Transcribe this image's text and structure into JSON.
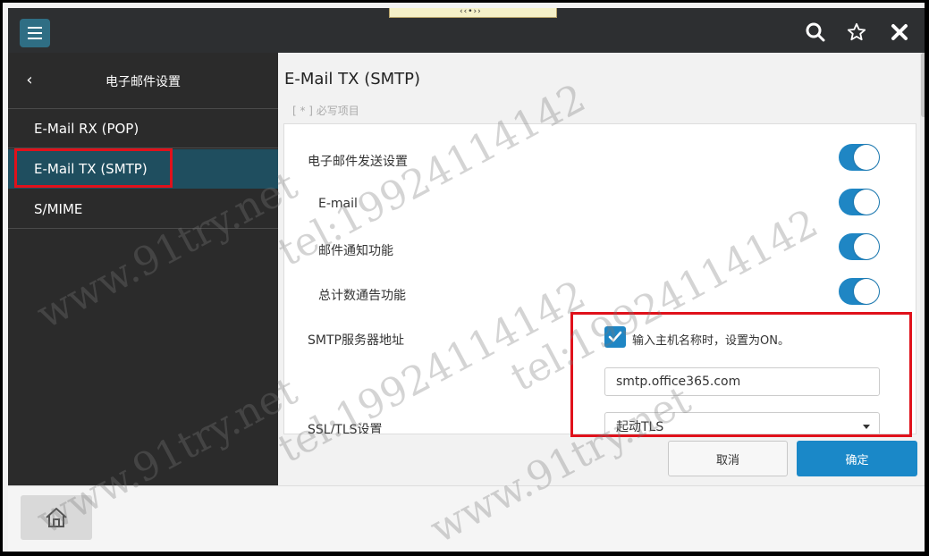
{
  "header": {
    "menu_icon": "hamburger-icon",
    "icons": [
      "search-icon",
      "star-icon",
      "close-icon"
    ]
  },
  "sidebar": {
    "title": "电子邮件设置",
    "items": [
      {
        "label": "E-Mail RX (POP)",
        "selected": false
      },
      {
        "label": "E-Mail TX (SMTP)",
        "selected": true
      },
      {
        "label": "S/MIME",
        "selected": false
      }
    ]
  },
  "main": {
    "title": "E-Mail TX (SMTP)",
    "required_note": "[ * ] 必写项目",
    "settings": [
      {
        "label": "电子邮件发送设置",
        "on": true
      },
      {
        "label": "E-mail",
        "on": true
      },
      {
        "label": "邮件通知功能",
        "on": true
      },
      {
        "label": "总计数通告功能",
        "on": true
      }
    ],
    "smtp_label": "SMTP服务器地址",
    "hostname_checkbox_label": "输入主机名称时，设置为ON。",
    "hostname_checked": true,
    "smtp_value": "smtp.office365.com",
    "ssl_label": "SSL/TLS设置",
    "ssl_value": "起动TLS",
    "cancel_label": "取消",
    "ok_label": "确定"
  },
  "footer": {
    "home_icon": "home-icon"
  },
  "colors": {
    "accent": "#1f86c4",
    "sidebar_bg": "#2b2b2b",
    "sidebar_selected": "#1f4e5f",
    "highlight_box": "#e0111b"
  },
  "watermarks": [
    "www.91try.net",
    "tel:19924114142"
  ]
}
